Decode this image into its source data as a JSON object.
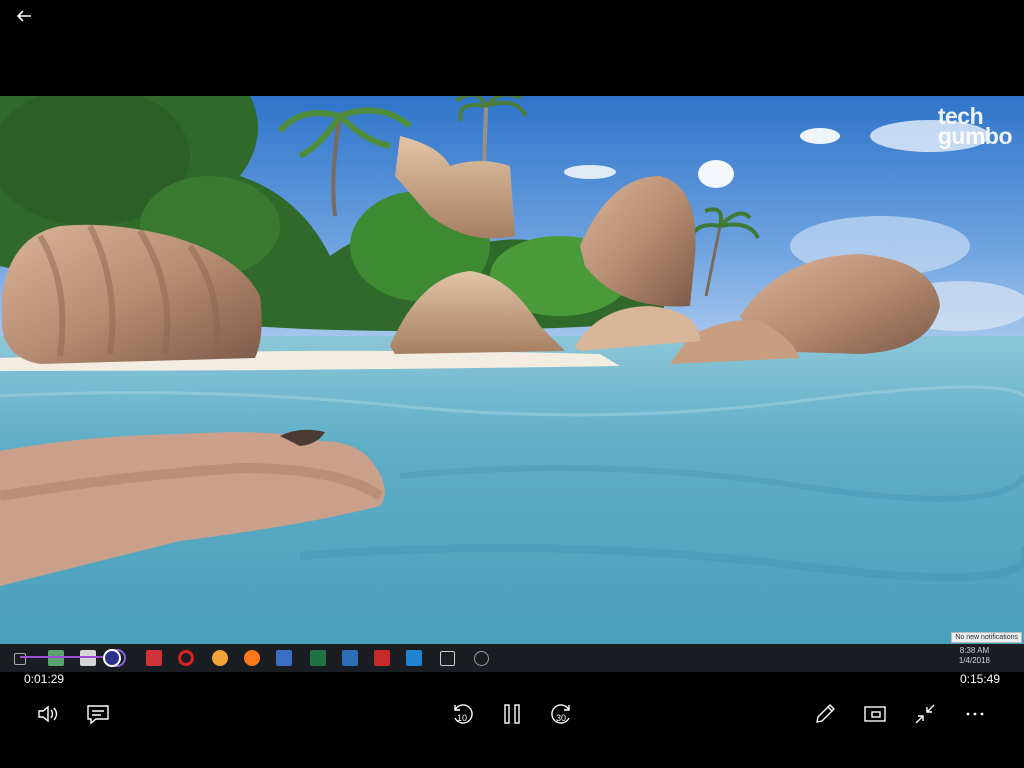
{
  "player": {
    "elapsed": "0:01:29",
    "total": "0:15:49",
    "progress": 0.094,
    "skip_back_seconds": "10",
    "skip_forward_seconds": "30",
    "state": "playing"
  },
  "video": {
    "watermark_line1": "tech",
    "watermark_line2": "gumbo",
    "embedded_taskbar": {
      "clock_time": "8:38 AM",
      "clock_date": "1/4/2018",
      "notification": "No new notifications"
    }
  },
  "colors": {
    "background": "#000000",
    "accent": "#9b4dd6",
    "controls": "#ffffff"
  },
  "icons": {
    "back": "arrow-left-icon",
    "volume": "speaker-icon",
    "subtitles": "caption-icon",
    "skip_back": "rewind-10-icon",
    "pause": "pause-icon",
    "skip_forward": "forward-30-icon",
    "draw": "pencil-icon",
    "cast": "cast-icon",
    "exit_fullscreen": "collapse-icon",
    "more": "ellipsis-icon"
  }
}
